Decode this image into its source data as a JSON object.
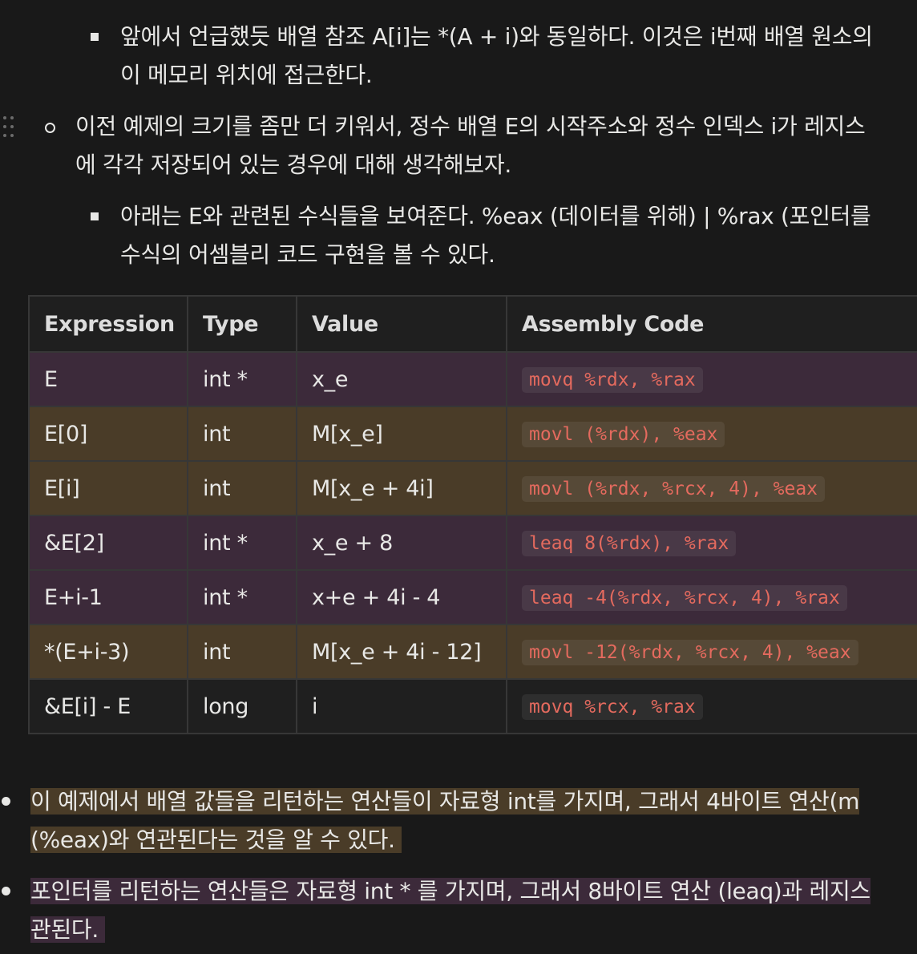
{
  "bullets": {
    "item1_line1": "앞에서 언급했듯 배열 참조 A[i]는 *(A + i)와 동일하다. 이것은 i번째 배열 원소의",
    "item1_line2": "이 메모리 위치에 접근한다.",
    "item2_line1": "이전 예제의 크기를 좀만 더 키워서, 정수 배열 E의 시작주소와 정수 인덱스 i가 레지스",
    "item2_line2": "에 각각 저장되어 있는 경우에 대해 생각해보자.",
    "item3_line1": "아래는 E와 관련된 수식들을 보여준다. %eax (데이터를 위해) | %rax (포인터를",
    "item3_line2": "수식의 어셈블리 코드 구현을 볼 수 있다."
  },
  "table": {
    "headers": [
      "Expression",
      "Type",
      "Value",
      "Assembly Code"
    ],
    "rows": [
      {
        "expr": "E",
        "type": "int *",
        "value": "x_e",
        "asm": "movq %rdx, %rax"
      },
      {
        "expr": "E[0]",
        "type": "int",
        "value": "M[x_e]",
        "asm": "movl (%rdx), %eax"
      },
      {
        "expr": "E[i]",
        "type": "int",
        "value": "M[x_e + 4i]",
        "asm": "movl (%rdx, %rcx, 4), %eax"
      },
      {
        "expr": "&E[2]",
        "type": "int *",
        "value": "x_e + 8",
        "asm": "leaq 8(%rdx), %rax"
      },
      {
        "expr": "E+i-1",
        "type": "int *",
        "value": "x+e + 4i - 4",
        "asm": "leaq -4(%rdx, %rcx, 4), %rax"
      },
      {
        "expr": "*(E+i-3)",
        "type": "int",
        "value": "M[x_e + 4i - 12]",
        "asm": "movl -12(%rdx, %rcx, 4), %eax"
      },
      {
        "expr": "&E[i] - E",
        "type": "long",
        "value": "i",
        "asm": "movq %rcx, %rax"
      }
    ]
  },
  "notes": {
    "note1_line1": "이 예제에서 배열 값들을 리턴하는 연산들이 자료형 int를 가지며, 그래서 4바이트 연산(m",
    "note1_line2": "(%eax)와 연관된다는 것을 알 수 있다.",
    "note2_line1": "포인터를 리턴하는 연산들은 자료형 int * 를 가지며, 그래서 8바이트 연산 (leaq)과 레지스",
    "note2_line2": "관된다."
  },
  "colors": {
    "background": "#191919",
    "row_purple": "#3c2a3a",
    "row_brown": "#4a3c28",
    "code_text": "#e46a5e"
  }
}
